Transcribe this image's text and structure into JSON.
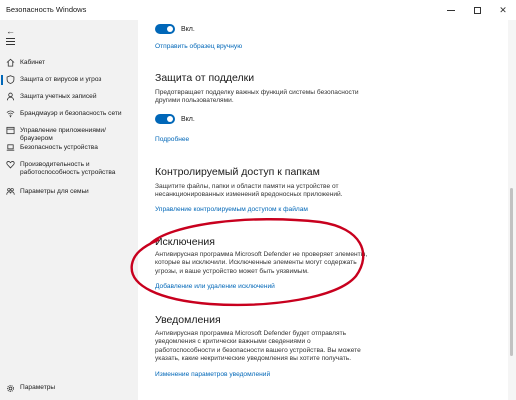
{
  "window": {
    "title": "Безопасность Windows"
  },
  "sidebar": {
    "back_glyph": "←",
    "items": [
      {
        "label": "Кабинет",
        "icon": "home-icon"
      },
      {
        "label": "Защита от вирусов и угроз",
        "icon": "shield-icon",
        "active": true
      },
      {
        "label": "Защита учетных записей",
        "icon": "person-icon"
      },
      {
        "label": "Брандмауэр и безопасность сети",
        "icon": "wifi-icon"
      },
      {
        "label": "Управление приложениями/браузером",
        "icon": "browser-icon"
      },
      {
        "label": "Безопасность устройства",
        "icon": "laptop-icon"
      },
      {
        "label": "Производительность и работоспособность устройства",
        "icon": "heart-icon"
      },
      {
        "label": "Параметры для семьи",
        "icon": "family-icon"
      }
    ],
    "settings_label": "Параметры"
  },
  "content": {
    "toggle1_label": "Вкл.",
    "send_sample_link": "Отправить образец вручную",
    "tamper": {
      "title": "Защита от подделки",
      "desc_line1": "Предотвращает подделку важных функций системы безопасности",
      "desc_line2": "другими пользователями.",
      "toggle_label": "Вкл.",
      "more_link": "Подробнее"
    },
    "cfa": {
      "title": "Контролируемый доступ к папкам",
      "desc_line1": "Защитите файлы, папки и области памяти на устройстве от",
      "desc_line2": "несанкционированных изменений вредоносных приложений.",
      "link": "Управление контролируемым доступом к файлам"
    },
    "exclusions": {
      "title": "Исключения",
      "desc_line1": "Антивирусная программа Microsoft Defender не проверяет элементы,",
      "desc_line2": "которые вы исключили. Исключенные элементы могут содержать",
      "desc_line3": "угрозы, и ваше устройство может быть уязвимым.",
      "link": "Добавление или удаление исключений"
    },
    "notifications": {
      "title": "Уведомления",
      "desc_line1": "Антивирусная программа Microsoft Defender будет отправлять",
      "desc_line2": "уведомления с критически важными сведениями о",
      "desc_line3": "работоспособности и безопасности вашего устройства. Вы можете",
      "desc_line4": "указать, какие некритические уведомления вы хотите получать.",
      "link": "Изменение параметров уведомлений"
    }
  },
  "colors": {
    "accent": "#0067b8",
    "annotation": "#c8001e",
    "sidebar_bg": "#f2f2f2"
  }
}
